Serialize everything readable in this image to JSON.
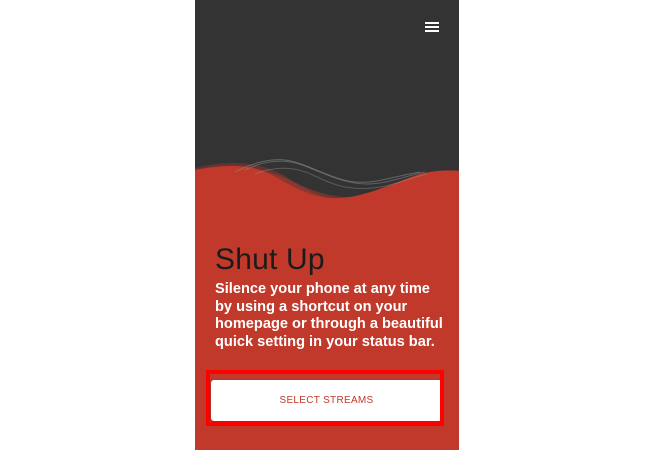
{
  "app": {
    "title": "Shut Up",
    "description": "Silence your phone at any time by using a shortcut on your homepage or through a beautiful quick setting in your status bar.",
    "primary_button_label": "SELECT STREAMS"
  },
  "toolbar": {
    "menu_icon": "hamburger-menu-icon"
  },
  "colors": {
    "header_background": "#333333",
    "accent": "#c0392b",
    "title_text": "#1c1b1b",
    "body_text": "#ffffff",
    "highlight": "#ff0000"
  }
}
